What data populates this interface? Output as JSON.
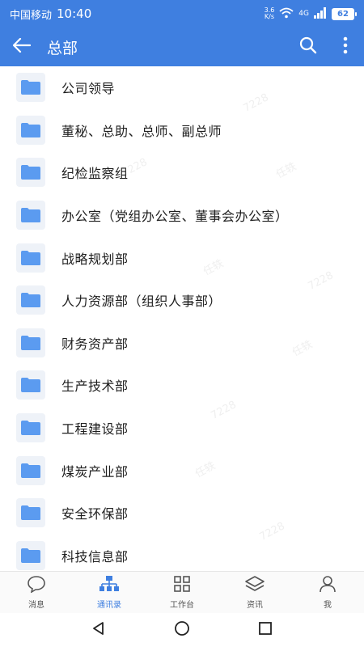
{
  "status": {
    "carrier": "中国移动",
    "time": "10:40",
    "net_speed_top": "3.6",
    "net_speed_bottom": "K/s",
    "network": "4G",
    "battery": "62"
  },
  "appbar": {
    "title": "总部"
  },
  "departments": [
    "公司领导",
    "董秘、总助、总师、副总师",
    "纪检监察组",
    "办公室（党组办公室、董事会办公室）",
    "战略规划部",
    "人力资源部（组织人事部）",
    "财务资产部",
    "生产技术部",
    "工程建设部",
    "煤炭产业部",
    "安全环保部",
    "科技信息部"
  ],
  "watermark": {
    "text_a": "任轶",
    "text_b": "7228"
  },
  "tabs": [
    {
      "label": "消息",
      "icon": "chat-bubble-icon"
    },
    {
      "label": "通讯录",
      "icon": "org-chart-icon",
      "active": true
    },
    {
      "label": "工作台",
      "icon": "grid-icon"
    },
    {
      "label": "资讯",
      "icon": "layers-icon"
    },
    {
      "label": "我",
      "icon": "person-icon"
    }
  ],
  "colors": {
    "accent": "#3f7fe0",
    "folder": "#5b9bf0"
  }
}
